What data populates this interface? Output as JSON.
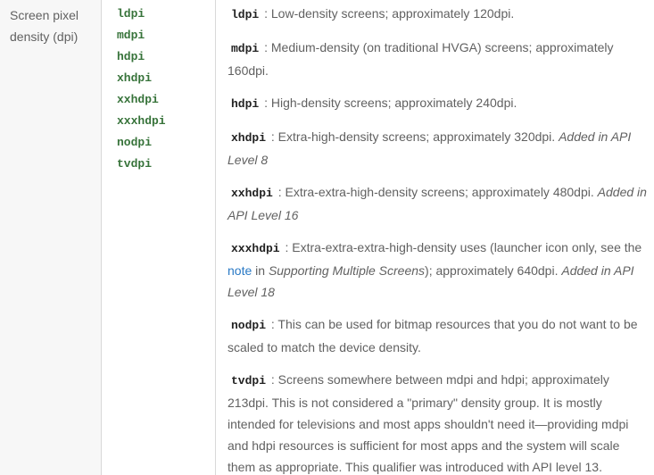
{
  "name_cell": {
    "line1": "Screen pixel",
    "line2": "density (dpi)"
  },
  "values": [
    "ldpi",
    "mdpi",
    "hdpi",
    "xhdpi",
    "xxhdpi",
    "xxxhdpi",
    "nodpi",
    "tvdpi"
  ],
  "descriptions": {
    "ldpi": {
      "code": "ldpi",
      "text": ": Low-density screens; approximately 120dpi."
    },
    "mdpi": {
      "code": "mdpi",
      "text": ": Medium-density (on traditional HVGA) screens; approximately 160dpi."
    },
    "hdpi": {
      "code": "hdpi",
      "text": ": High-density screens; approximately 240dpi."
    },
    "xhdpi": {
      "code": "xhdpi",
      "text": ": Extra-high-density screens; approximately 320dpi.",
      "added": "Added in API Level 8"
    },
    "xxhdpi": {
      "code": "xxhdpi",
      "text": ": Extra-extra-high-density screens; approximately 480dpi.",
      "added": "Added in API Level 16"
    },
    "xxxhdpi": {
      "code": "xxxhdpi",
      "text_a": ": Extra-extra-extra-high-density uses (launcher icon only, see the",
      "link": "note",
      "text_b": "in",
      "ref": "Supporting Multiple Screens",
      "text_c": "); approximately 640dpi.",
      "added": "Added in API Level 18"
    },
    "nodpi": {
      "code": "nodpi",
      "text": ": This can be used for bitmap resources that you do not want to be scaled to match the device density."
    },
    "tvdpi": {
      "code": "tvdpi",
      "text": ": Screens somewhere between mdpi and hdpi; approximately 213dpi. This is not considered a \"primary\" density group. It is mostly intended for televisions and most apps shouldn't need it—providing mdpi and hdpi resources is sufficient for most apps and the system will scale them as appropriate. This qualifier was introduced with API level 13."
    }
  },
  "colors": {
    "qualifier_green": "#37733a",
    "link_blue": "#2979c5",
    "name_cell_bg": "#f7f7f7",
    "body_text": "#616161"
  }
}
